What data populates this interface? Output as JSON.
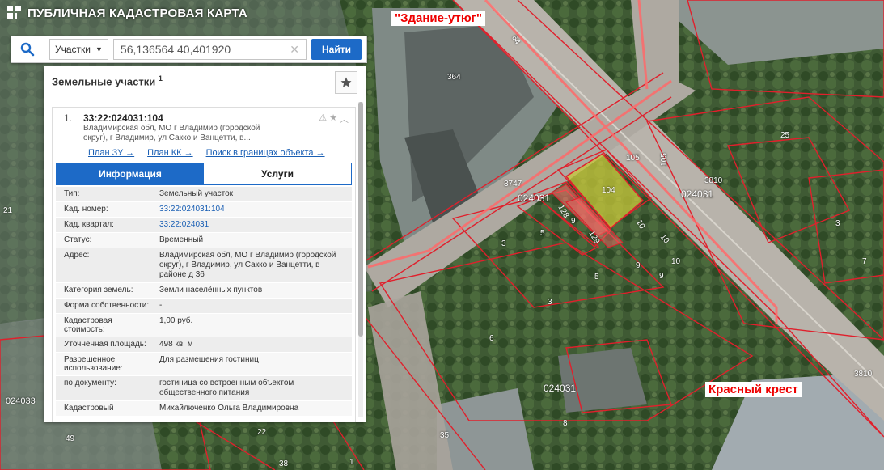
{
  "header": {
    "title": "ПУБЛИЧНАЯ КАДАСТРОВАЯ КАРТА"
  },
  "search": {
    "type_label": "Участки",
    "query": "56,136564 40,401920",
    "find_label": "Найти"
  },
  "panel": {
    "title": "Земельные участки",
    "count": "1",
    "result": {
      "number": "1.",
      "cad_number": "33:22:024031:104",
      "address_lines": [
        "Владимирская обл, МО г Владимир (городской",
        "округ), г Владимир, ул Сакко и Ванцетти, в..."
      ],
      "links": [
        "План ЗУ →",
        "План КК →",
        "Поиск в границах объекта →"
      ],
      "tabs": [
        "Информация",
        "Услуги"
      ],
      "fields": [
        {
          "key": "Тип:",
          "value": "Земельный участок"
        },
        {
          "key": "Кад. номер:",
          "value": "33:22:024031:104",
          "link": true
        },
        {
          "key": "Кад. квартал:",
          "value": "33:22:024031",
          "link": true
        },
        {
          "key": "Статус:",
          "value": "Временный"
        },
        {
          "key": "Адрес:",
          "value": "Владимирская обл, МО г Владимир (городской округ), г Владимир, ул Сакко и Ванцетти, в районе д 36"
        },
        {
          "key": "Категория земель:",
          "value": "Земли населённых пунктов"
        },
        {
          "key": "Форма собственности:",
          "value": "-"
        },
        {
          "key": "Кадастровая стоимость:",
          "value": "1,00 руб."
        },
        {
          "key": "Уточненная площадь:",
          "value": "498 кв. м"
        },
        {
          "key": "Разрешенное использование:",
          "value": "Для размещения гостиниц"
        },
        {
          "key": "по документу:",
          "value": "гостиница со встроенным объектом общественного питания"
        },
        {
          "key": "Кадастровый",
          "value": "Михайлюченко Ольга Владимировна"
        }
      ]
    }
  },
  "map": {
    "overlay_labels": [
      "\"Здание-утюг\"",
      "Красный крест"
    ],
    "parcel_labels": [
      "364",
      "64",
      "105",
      "105",
      "104",
      "3747",
      "024031",
      "024031",
      "128",
      "9",
      "129",
      "10",
      "10",
      "10",
      "3810",
      "25",
      "3",
      "7",
      "5",
      "3",
      "5",
      "9",
      "9",
      "3",
      "6",
      "024031",
      "8",
      "3810",
      "21",
      "024033",
      "49",
      "22",
      "35",
      "38",
      "1"
    ]
  },
  "colors": {
    "accent": "#1d6ac7",
    "parcel_border": "#e0202c",
    "selected_fill": "#c8c83a"
  }
}
